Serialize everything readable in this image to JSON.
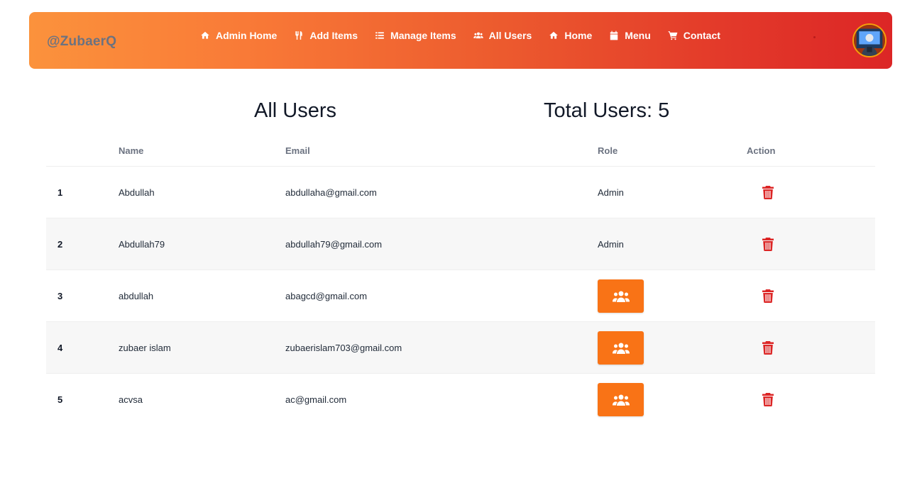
{
  "navbar": {
    "brand": "@ZubaerQ",
    "links": [
      {
        "label": "Admin Home",
        "icon": "home-icon"
      },
      {
        "label": "Add Items",
        "icon": "utensils-icon"
      },
      {
        "label": "Manage Items",
        "icon": "list-icon"
      },
      {
        "label": "All Users",
        "icon": "users-icon"
      },
      {
        "label": "Home",
        "icon": "home-icon"
      },
      {
        "label": "Menu",
        "icon": "calendar-icon"
      },
      {
        "label": "Contact",
        "icon": "cart-icon"
      }
    ],
    "avatar_icon": "user-avatar"
  },
  "page": {
    "title": "All Users",
    "total_label": "Total Users: 5"
  },
  "table": {
    "columns": [
      "",
      "Name",
      "Email",
      "Role",
      "Action"
    ],
    "rows": [
      {
        "index": "1",
        "name": "Abdullah",
        "email": "abdullaha@gmail.com",
        "role": "Admin"
      },
      {
        "index": "2",
        "name": "Abdullah79",
        "email": "abdullah79@gmail.com",
        "role": "Admin"
      },
      {
        "index": "3",
        "name": "abdullah",
        "email": "abagcd@gmail.com",
        "role": ""
      },
      {
        "index": "4",
        "name": "zubaer islam",
        "email": "zubaerislam703@gmail.com",
        "role": ""
      },
      {
        "index": "5",
        "name": "acvsa",
        "email": "ac@gmail.com",
        "role": ""
      }
    ],
    "role_button_icon": "users-icon",
    "action_icon": "trash-icon"
  },
  "colors": {
    "gradient_start": "#fb923c",
    "gradient_end": "#dc2626",
    "role_button": "#f97316",
    "delete_icon": "#dc2626"
  }
}
